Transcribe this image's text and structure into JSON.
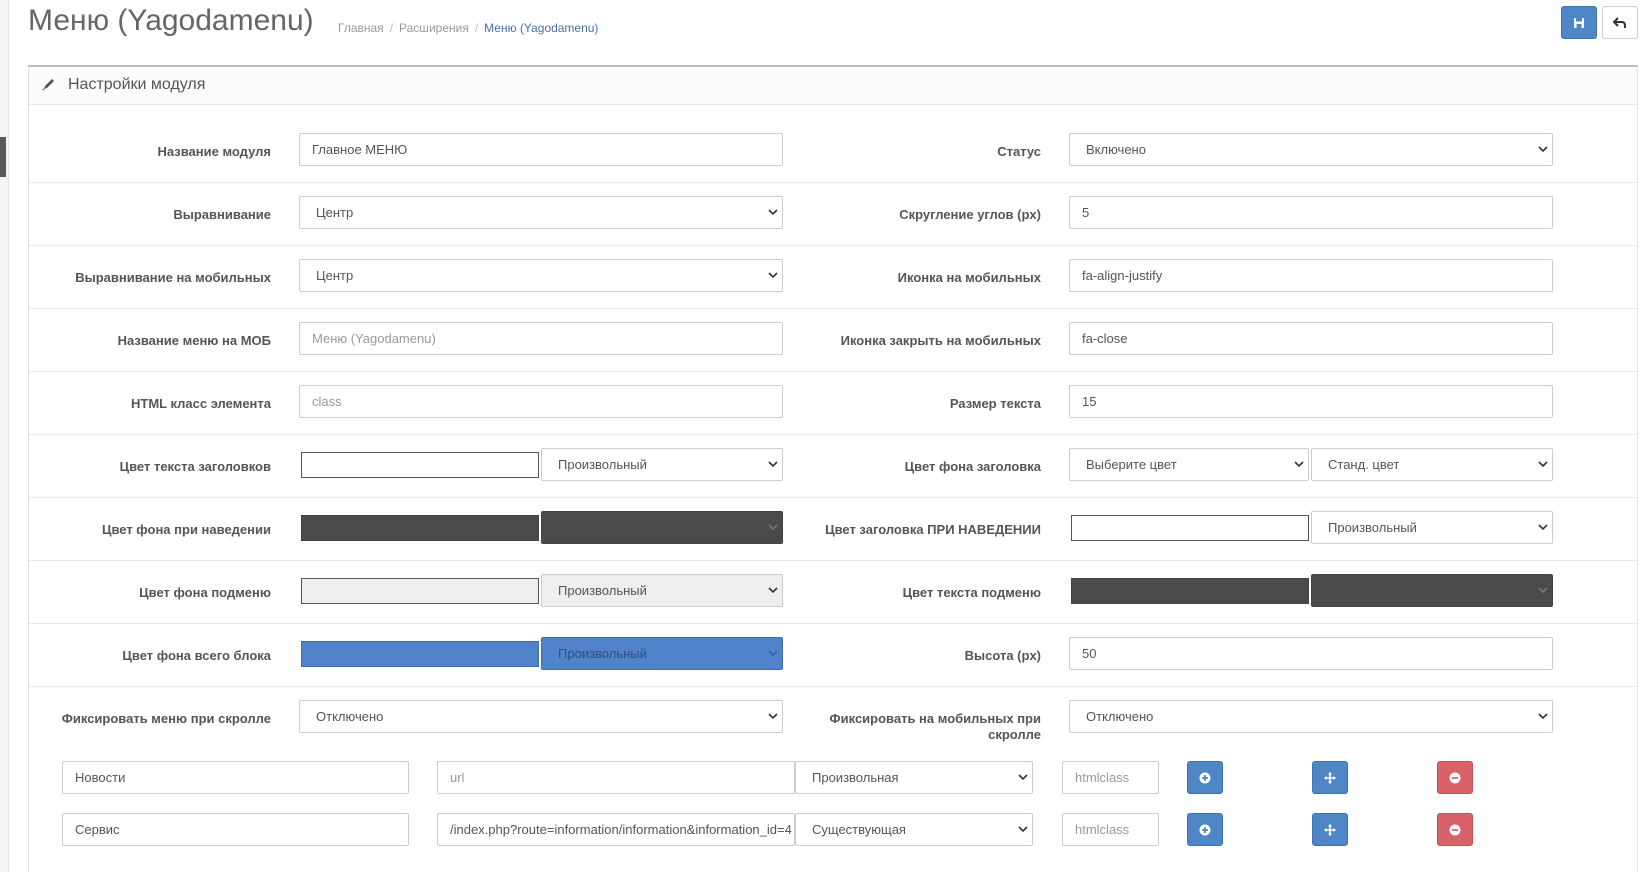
{
  "header": {
    "title": "Меню (Yagodamenu)",
    "breadcrumb": [
      "Главная",
      "Расширения",
      "Меню (Yagodamenu)"
    ],
    "separator": "/",
    "save_icon": "floppy-disk-icon",
    "back_icon": "reply-arrow-icon"
  },
  "panel": {
    "title": "Настройки модуля",
    "icon": "pencil-icon"
  },
  "form": {
    "module_name": {
      "label": "Название модуля",
      "value": "Главное МЕНЮ"
    },
    "status": {
      "label": "Статус",
      "value": "Включено"
    },
    "align": {
      "label": "Выравнивание",
      "value": "Центр"
    },
    "radius": {
      "label": "Скругление углов (px)",
      "value": "5"
    },
    "align_mobile": {
      "label": "Выравнивание на мобильных",
      "value": "Центр"
    },
    "icon_mobile": {
      "label": "Иконка на мобильных",
      "value": "fa-align-justify"
    },
    "menu_name_mob": {
      "label": "Название меню на МОБ",
      "placeholder": "Меню (Yagodamenu)"
    },
    "icon_close_mobile": {
      "label": "Иконка закрыть на мобильных",
      "value": "fa-close"
    },
    "html_class": {
      "label": "HTML класс элемента",
      "placeholder": "class"
    },
    "text_size": {
      "label": "Размер текста",
      "value": "15"
    },
    "header_text_color": {
      "label": "Цвет текста заголовков",
      "swatch": "#ffffff",
      "mode": "Произвольный"
    },
    "header_bg_color": {
      "label": "Цвет фона заголовка",
      "choose": "Выберите цвет",
      "mode": "Станд. цвет"
    },
    "hover_bg_color": {
      "label": "Цвет фона при наведении",
      "swatch": "#4a4a4a",
      "mode": ""
    },
    "hover_header_color": {
      "label": "Цвет заголовка ПРИ НАВЕДЕНИИ",
      "swatch": "#ffffff",
      "mode": "Произвольный"
    },
    "submenu_bg_color": {
      "label": "Цвет фона подменю",
      "swatch": "#eeeeee",
      "mode": "Произвольный"
    },
    "submenu_text_color": {
      "label": "Цвет текста подменю",
      "swatch": "#4a4a4a",
      "mode": ""
    },
    "block_bg_color": {
      "label": "Цвет фона всего блока",
      "swatch": "#5083c9",
      "mode": "Произвольный"
    },
    "height": {
      "label": "Высота (px)",
      "value": "50"
    },
    "fix_scroll": {
      "label": "Фиксировать меню при скролле",
      "value": "Отключено"
    },
    "fix_mobile": {
      "label": "Фиксировать на мобильных при скролле",
      "value": "Отключено"
    }
  },
  "menu_items": [
    {
      "title": "Новости",
      "url": "",
      "url_placeholder": "url",
      "type": "Произвольная",
      "class_placeholder": "htmlclass"
    },
    {
      "title": "Сервис",
      "url": "/index.php?route=information/information&information_id=4",
      "url_placeholder": "url",
      "type": "Существующая",
      "class_placeholder": "htmlclass"
    }
  ],
  "item_buttons": {
    "add_icon": "plus-circle-icon",
    "move_icon": "move-arrows-icon",
    "remove_icon": "minus-circle-icon"
  },
  "colors": {
    "primary": "#4f86c6",
    "danger": "#d9626a",
    "dark_swatch": "#4a4a4a"
  }
}
